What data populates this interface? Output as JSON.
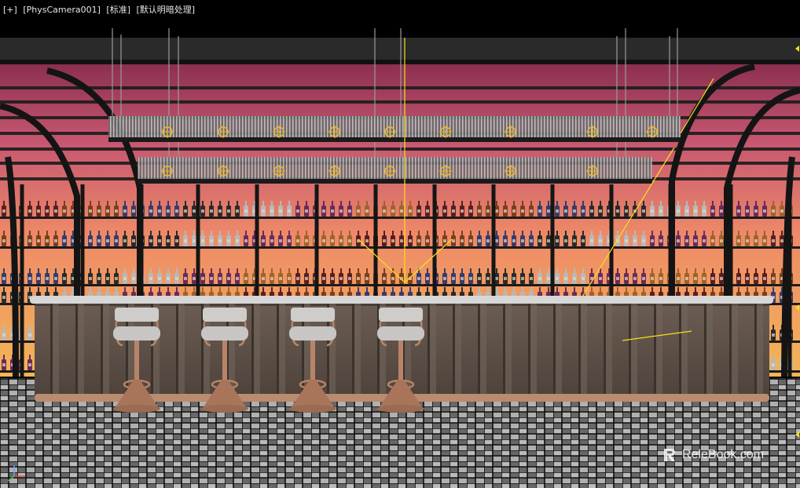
{
  "viewport": {
    "label_plus": "[+]",
    "label_camera": "[PhysCamera001]",
    "label_shading": "[标准]",
    "label_lighting": "[默认明暗处理]"
  },
  "watermark": {
    "text": "ReleBook.com",
    "brand_mark": "R"
  },
  "icons": {
    "axis": "axis-gizmo-icon",
    "brand": "relebook-logo-icon"
  },
  "colors": {
    "background": "#000000",
    "backwall_top": "#c0506e",
    "backwall_bottom": "#f0a050",
    "frame": "#1a1a1a",
    "counter": "#5b4e45",
    "stool_metal": "#b88468",
    "stool_seat": "#c8c6c4",
    "ceiling_lamps": "#e8b830",
    "selection_lines": "#f0e020"
  }
}
